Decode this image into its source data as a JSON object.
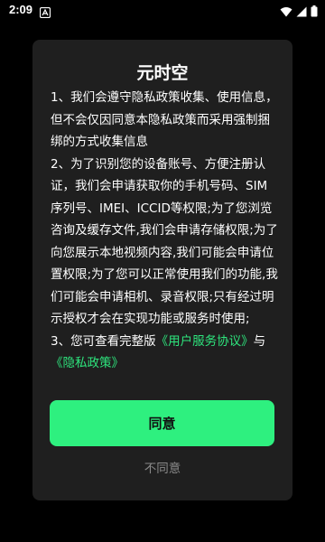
{
  "status_bar": {
    "time": "2:09",
    "icons": [
      "notification-a-icon",
      "wifi-icon",
      "signal-icon",
      "battery-icon"
    ]
  },
  "dialog": {
    "title": "元时空",
    "paragraphs": {
      "p1": "1、我们会遵守隐私政策收集、使用信息，但不会仅因同意本隐私政策而采用强制捆绑的方式收集信息",
      "p2": "2、为了识别您的设备账号、方便注册认证，我们会申请获取你的手机号码、SIM序列号、IMEI、ICCID等权限;为了您浏览咨询及缓存文件,我们会申请存储权限;为了向您展示本地视频内容,我们可能会申请位置权限;为了您可以正常使用我们的功能,我们可能会申请相机、录音权限;只有经过明示授权才会在实现功能或服务时使用;",
      "p3_prefix": "3、您可查看完整版",
      "user_agreement_link": "《用户服务协议》",
      "p3_connector": "与",
      "privacy_policy_link": "《隐私政策》"
    },
    "agree_label": "同意",
    "disagree_label": "不同意"
  },
  "colors": {
    "background": "#000000",
    "dialog_bg": "#1f1f1f",
    "accent": "#2ef07f",
    "link": "#2ee57d",
    "muted_text": "#8a8a8a"
  }
}
